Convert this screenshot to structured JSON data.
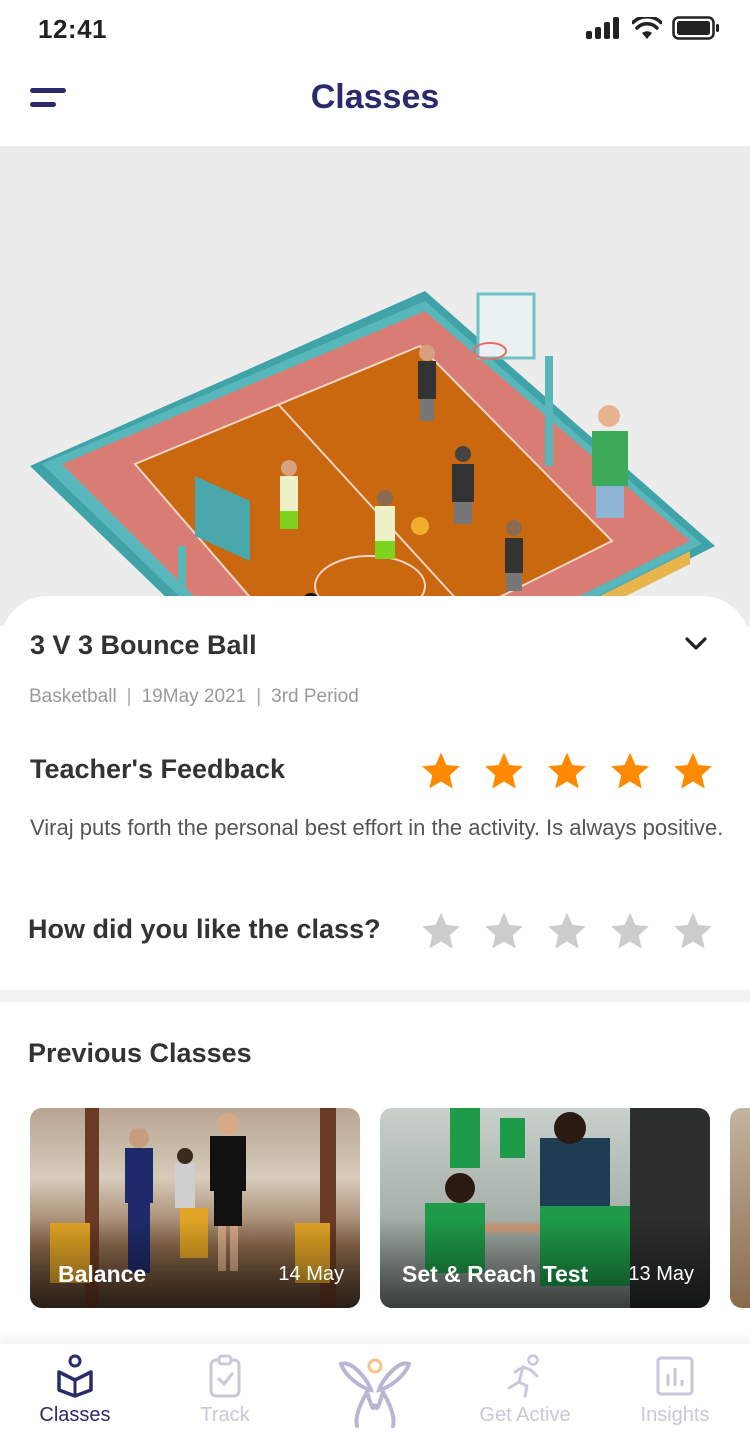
{
  "status_bar": {
    "time": "12:41"
  },
  "header": {
    "title": "Classes"
  },
  "current_class": {
    "title": "3 V 3 Bounce Ball",
    "sport": "Basketball",
    "date": "19May 2021",
    "period": "3rd Period",
    "separator": "|"
  },
  "teacher_feedback": {
    "title": "Teacher's Feedback",
    "rating": 5,
    "max_rating": 5,
    "text": "Viraj puts forth the personal best effort in the activity. Is always positive."
  },
  "student_rating": {
    "question": "How did you like the class?",
    "rating": 0,
    "max_rating": 5
  },
  "previous_classes": {
    "title": "Previous Classes",
    "items": [
      {
        "name": "Balance",
        "date": "14 May"
      },
      {
        "name": "Set & Reach Test",
        "date": "13 May"
      }
    ]
  },
  "bottom_nav": {
    "items": [
      {
        "label": "Classes",
        "icon": "book-reader-icon",
        "active": true
      },
      {
        "label": "Track",
        "icon": "clipboard-check-icon",
        "active": false
      },
      {
        "label": "",
        "icon": "app-logo-icon",
        "active": false
      },
      {
        "label": "Get Active",
        "icon": "running-person-icon",
        "active": false
      },
      {
        "label": "Insights",
        "icon": "bar-chart-icon",
        "active": false
      }
    ]
  },
  "colors": {
    "primary": "#2b2a6b",
    "star_active": "#ff8a00",
    "star_inactive": "#cccccc",
    "nav_inactive": "#c9c7d9"
  }
}
